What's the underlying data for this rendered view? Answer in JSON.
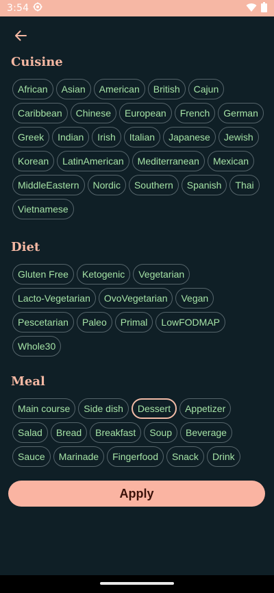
{
  "status_bar": {
    "time": "3:54",
    "icons": [
      "settings-icon",
      "wifi-icon",
      "battery-icon"
    ],
    "background": "#f6b7a4"
  },
  "colors": {
    "background": "#0f1f26",
    "accent": "#f5b8a3",
    "chip_text": "#a5e3a6",
    "chip_border": "#56656b",
    "apply_bg": "#fab4a2",
    "apply_text": "#3b1109"
  },
  "back_button": {
    "icon": "arrow-left-icon"
  },
  "sections": {
    "cuisine": {
      "title": "Cuisine",
      "items": [
        "African",
        "Asian",
        "American",
        "British",
        "Cajun",
        "Caribbean",
        "Chinese",
        "European",
        "French",
        "German",
        "Greek",
        "Indian",
        "Irish",
        "Italian",
        "Japanese",
        "Jewish",
        "Korean",
        "LatinAmerican",
        "Mediterranean",
        "Mexican",
        "MiddleEastern",
        "Nordic",
        "Southern",
        "Spanish",
        "Thai",
        "Vietnamese"
      ]
    },
    "diet": {
      "title": "Diet",
      "items": [
        "Gluten Free",
        "Ketogenic",
        "Vegetarian",
        "Lacto-Vegetarian",
        "OvoVegetarian",
        "Vegan",
        "Pescetarian",
        "Paleo",
        "Primal",
        "LowFODMAP",
        "Whole30"
      ]
    },
    "meal": {
      "title": "Meal",
      "selected": "Dessert",
      "items": [
        "Main course",
        "Side dish",
        "Dessert",
        "Appetizer",
        "Salad",
        "Bread",
        "Breakfast",
        "Soup",
        "Beverage",
        "Sauce",
        "Marinade",
        "Fingerfood",
        "Snack",
        "Drink"
      ]
    }
  },
  "apply_label": "Apply"
}
